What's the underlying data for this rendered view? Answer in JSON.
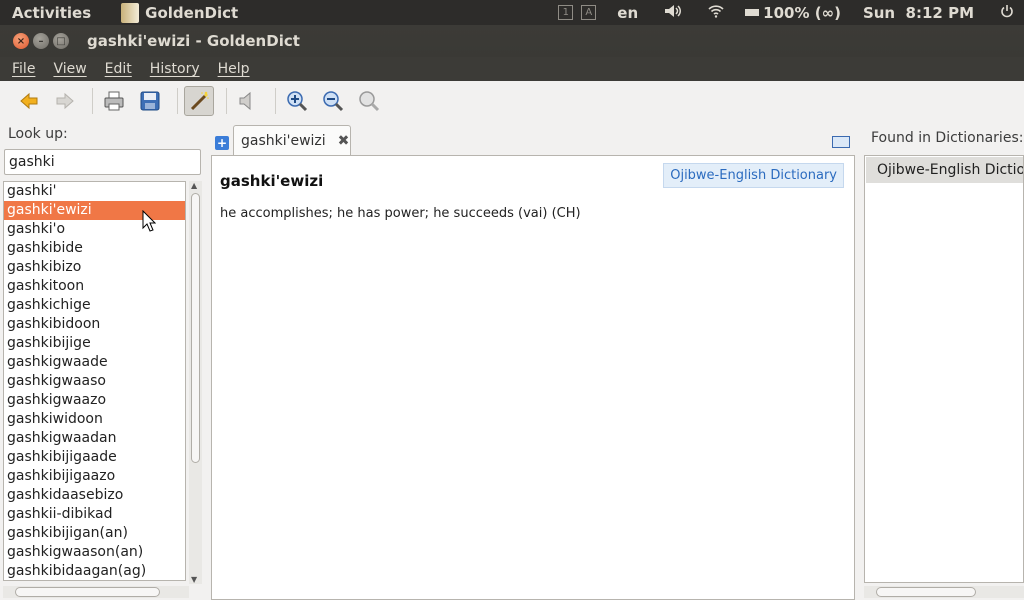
{
  "top_panel": {
    "activities": "Activities",
    "app_name": "GoldenDict",
    "kbd_indicators": [
      "1",
      "A"
    ],
    "language": "en",
    "battery": "100% (∞)",
    "clock": "Sun  8:12 PM"
  },
  "window": {
    "title": "gashki'ewizi - GoldenDict"
  },
  "menu": {
    "items": [
      "File",
      "View",
      "Edit",
      "History",
      "Help"
    ]
  },
  "toolbar": {
    "icons": [
      "back-icon",
      "forward-icon",
      "print-icon",
      "save-icon",
      "scan-popup-icon",
      "pronounce-icon",
      "zoom-in-icon",
      "zoom-out-icon",
      "zoom-reset-icon"
    ]
  },
  "left_pane": {
    "lookup_label": "Look up:",
    "lookup_value": "gashki",
    "words": [
      "gashki'",
      "gashki'ewizi",
      "gashki'o",
      "gashkibide",
      "gashkibizo",
      "gashkitoon",
      "gashkichige",
      "gashkibidoon",
      "gashkibijige",
      "gashkigwaade",
      "gashkigwaaso",
      "gashkigwaazo",
      "gashkiwidoon",
      "gashkigwaadan",
      "gashkibijigaade",
      "gashkibijigaazo",
      "gashkidaasebizo",
      "gashkii-dibikad",
      "gashkibijigan(an)",
      "gashkigwaason(an)",
      "gashkibidaagan(ag)"
    ],
    "selected_index": 1
  },
  "article": {
    "tab_label": "gashki'ewizi",
    "headword": "gashki'ewizi",
    "dictionary_name": "Ojibwe-English Dictionary",
    "definition": "he accomplishes; he has power; he succeeds (vai) (CH)"
  },
  "right_pane": {
    "found_label": "Found in Dictionaries:",
    "dictionaries": [
      "Ojibwe-English Dictionary"
    ]
  },
  "colors": {
    "selection": "#f07746",
    "panel": "#2d2c2a",
    "accent": "#2b6bbf"
  }
}
